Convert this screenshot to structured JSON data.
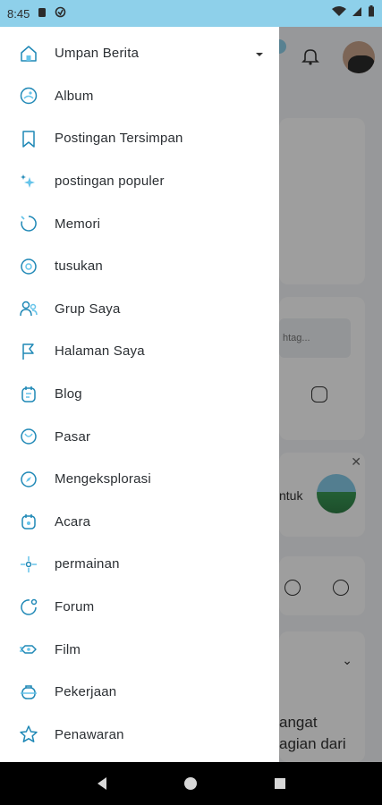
{
  "status_bar": {
    "time": "8:45"
  },
  "drawer": {
    "items": [
      {
        "label": "Umpan Berita",
        "icon": "home-icon",
        "has_dropdown": true
      },
      {
        "label": "Album",
        "icon": "album-icon"
      },
      {
        "label": "Postingan Tersimpan",
        "icon": "bookmark-icon"
      },
      {
        "label": "postingan populer",
        "icon": "sparkles-icon"
      },
      {
        "label": "Memori",
        "icon": "memories-icon"
      },
      {
        "label": "tusukan",
        "icon": "poke-icon"
      },
      {
        "label": "Grup Saya",
        "icon": "groups-icon"
      },
      {
        "label": "Halaman Saya",
        "icon": "flag-icon"
      },
      {
        "label": "Blog",
        "icon": "blog-icon"
      },
      {
        "label": "Pasar",
        "icon": "market-icon"
      },
      {
        "label": "Mengeksplorasi",
        "icon": "compass-icon"
      },
      {
        "label": "Acara",
        "icon": "calendar-icon"
      },
      {
        "label": "permainan",
        "icon": "games-icon"
      },
      {
        "label": "Forum",
        "icon": "forum-icon"
      },
      {
        "label": "Film",
        "icon": "film-icon"
      },
      {
        "label": "Pekerjaan",
        "icon": "jobs-icon"
      },
      {
        "label": "Penawaran",
        "icon": "offers-star-icon"
      }
    ]
  },
  "background": {
    "hashtag_placeholder": "htag...",
    "suggestion_text_partial": "ntuk",
    "post_text_line1": "angat",
    "post_text_line2": "agian dari"
  },
  "colors": {
    "status_bar": "#8ed0ea",
    "icon_accent": "#1f88b6",
    "icon_light": "#66c4ea"
  }
}
